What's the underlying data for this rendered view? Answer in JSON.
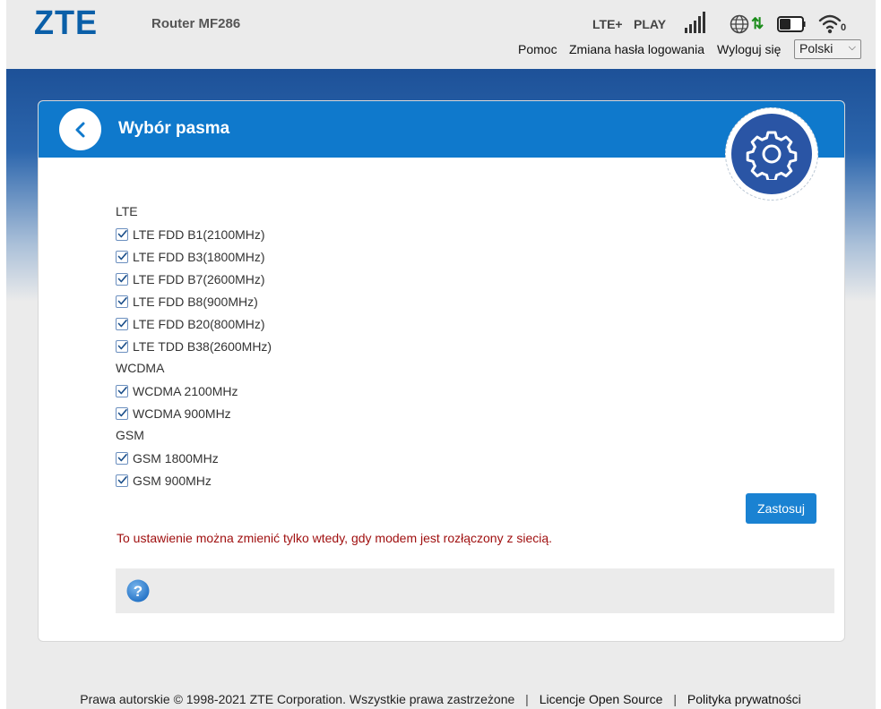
{
  "header": {
    "logo": "ZTE",
    "router_name": "Router MF286",
    "network_type": "LTE+",
    "operator": "PLAY",
    "wifi_clients": "0",
    "links": {
      "help": "Pomoc",
      "change_password": "Zmiana hasła logowania",
      "logout": "Wyloguj się"
    },
    "language": "Polski",
    "icons": [
      "signal-strength-icon",
      "globe-icon",
      "data-transfer-icon",
      "battery-icon",
      "wifi-icon"
    ]
  },
  "card": {
    "title": "Wybór pasma",
    "back_icon": "chevron-left-icon",
    "badge_icon": "gear-icon"
  },
  "groups": {
    "lte": {
      "label": "LTE",
      "items": [
        {
          "label": "LTE FDD B1(2100MHz)",
          "checked": true
        },
        {
          "label": "LTE FDD B3(1800MHz)",
          "checked": true
        },
        {
          "label": "LTE FDD B7(2600MHz)",
          "checked": true
        },
        {
          "label": "LTE FDD B8(900MHz)",
          "checked": true
        },
        {
          "label": "LTE FDD B20(800MHz)",
          "checked": true
        },
        {
          "label": "LTE TDD B38(2600MHz)",
          "checked": true
        }
      ]
    },
    "wcdma": {
      "label": "WCDMA",
      "items": [
        {
          "label": "WCDMA 2100MHz",
          "checked": true
        },
        {
          "label": "WCDMA 900MHz",
          "checked": true
        }
      ]
    },
    "gsm": {
      "label": "GSM",
      "items": [
        {
          "label": "GSM 1800MHz",
          "checked": true
        },
        {
          "label": "GSM 900MHz",
          "checked": true
        }
      ]
    }
  },
  "apply_label": "Zastosuj",
  "warning": "To ustawienie można zmienić tylko wtedy, gdy modem jest rozłączony z siecią.",
  "help_icon": "question-mark-icon",
  "footer": {
    "copyright": "Prawa autorskie © 1998-2021 ZTE Corporation. Wszystkie prawa zastrzeżone",
    "open_source": "Licencje Open Source",
    "privacy": "Polityka prywatności"
  },
  "colors": {
    "brand_blue": "#0a5fa8",
    "header_blue": "#0f79cc",
    "button_blue": "#1a82d2",
    "warning_red": "#a01010",
    "transfer_green": "#1a8c1a"
  }
}
